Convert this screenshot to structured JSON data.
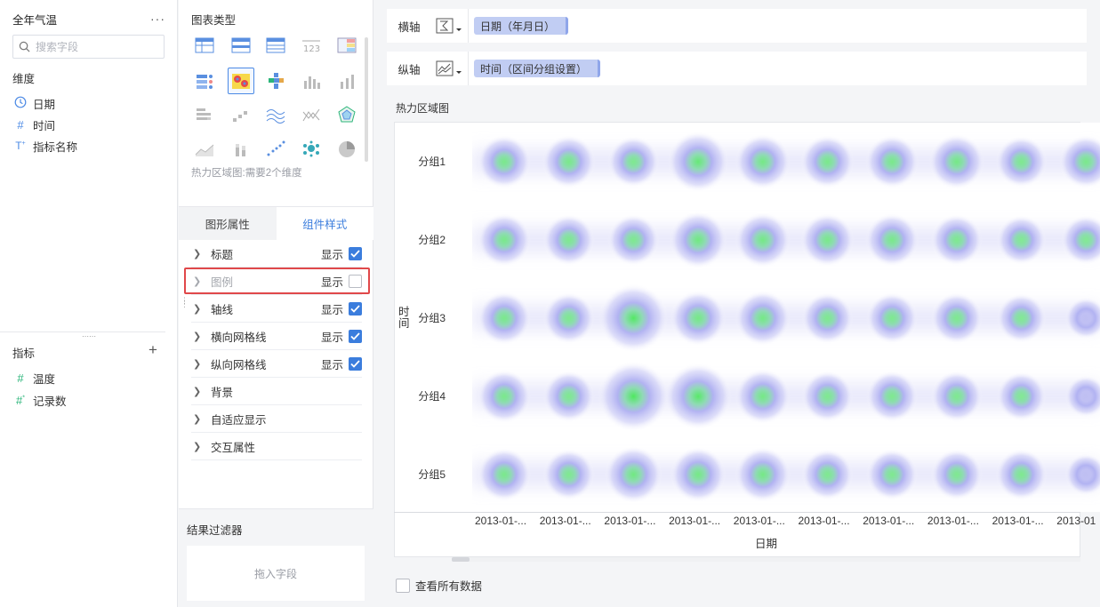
{
  "data_panel": {
    "dataset_title": "全年气温",
    "more_icon": "more-horizontal-icon",
    "search_placeholder": "搜索字段",
    "dimension_title": "维度",
    "dimensions": [
      {
        "label": "日期",
        "icon": "clock-icon"
      },
      {
        "label": "时间",
        "icon": "number-hash-icon"
      },
      {
        "label": "指标名称",
        "icon": "text-type-icon"
      }
    ],
    "measure_title": "指标",
    "measures": [
      {
        "label": "温度",
        "icon": "number-hash-icon"
      },
      {
        "label": "记录数",
        "icon": "number-hash-star-icon"
      }
    ]
  },
  "config_panel": {
    "chart_type_title": "图表类型",
    "chart_type_hint": "热力区域图:需要2个维度",
    "selected_chart_type": "heat-area-map",
    "tabs": [
      {
        "label": "图形属性",
        "active": false
      },
      {
        "label": "组件样式",
        "active": true
      }
    ],
    "properties": [
      {
        "label": "标题",
        "show": "显示",
        "checked": true,
        "has_checkbox": true
      },
      {
        "label": "图例",
        "show": "显示",
        "checked": false,
        "has_checkbox": true,
        "highlighted": true
      },
      {
        "label": "轴线",
        "show": "显示",
        "checked": true,
        "has_checkbox": true
      },
      {
        "label": "横向网格线",
        "show": "显示",
        "checked": true,
        "has_checkbox": true
      },
      {
        "label": "纵向网格线",
        "show": "显示",
        "checked": true,
        "has_checkbox": true
      },
      {
        "label": "背景",
        "has_checkbox": false
      },
      {
        "label": "自适应显示",
        "has_checkbox": false
      },
      {
        "label": "交互属性",
        "has_checkbox": false
      }
    ],
    "filter_title": "结果过滤器",
    "filter_drop_hint": "拖入字段"
  },
  "axes": {
    "x_label": "横轴",
    "x_field": "日期（年月日）",
    "y_label": "纵轴",
    "y_field": "时间（区间分组设置）"
  },
  "chart_data": {
    "type": "heatmap",
    "title": "热力区域图",
    "xlabel": "日期",
    "ylabel": "时间",
    "x_ticks": [
      "2013-01-...",
      "2013-01-...",
      "2013-01-...",
      "2013-01-...",
      "2013-01-...",
      "2013-01-...",
      "2013-01-...",
      "2013-01-...",
      "2013-01-...",
      "2013-01"
    ],
    "y_ticks": [
      "分组1",
      "分组2",
      "分组3",
      "分组4",
      "分组5"
    ],
    "intensity": [
      [
        0.55,
        0.55,
        0.5,
        0.75,
        0.6,
        0.55,
        0.55,
        0.6,
        0.5,
        0.55
      ],
      [
        0.55,
        0.5,
        0.5,
        0.65,
        0.6,
        0.55,
        0.55,
        0.5,
        0.45,
        0.45
      ],
      [
        0.55,
        0.5,
        0.95,
        0.6,
        0.6,
        0.5,
        0.5,
        0.5,
        0.45,
        0.25
      ],
      [
        0.55,
        0.5,
        1.0,
        0.9,
        0.6,
        0.5,
        0.5,
        0.5,
        0.45,
        0.25
      ],
      [
        0.55,
        0.5,
        0.65,
        0.6,
        0.6,
        0.5,
        0.5,
        0.5,
        0.5,
        0.25
      ]
    ],
    "colors": {
      "low": "#b9b9f2",
      "high": "#48e858"
    },
    "legend": false
  },
  "footer": {
    "view_all_label": "查看所有数据",
    "view_all_checked": false
  },
  "colors": {
    "accent": "#3b7ddd",
    "highlight_border": "#e0484a",
    "pill_bg": "#c1cdf3"
  }
}
